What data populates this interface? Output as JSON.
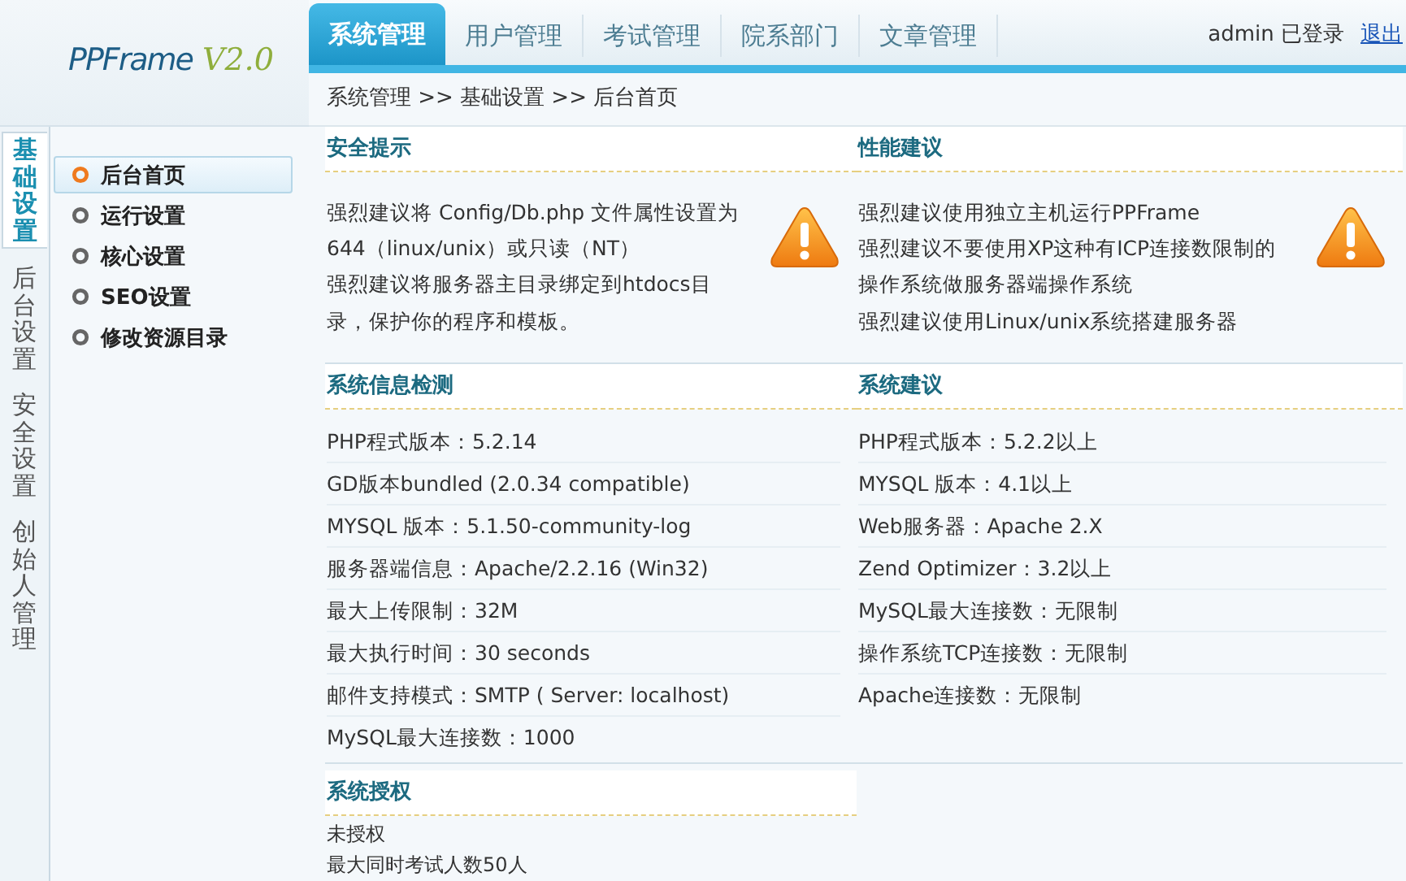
{
  "logo": {
    "name": "PPFrame",
    "version": "V2.0"
  },
  "tabs": [
    {
      "label": "系统管理",
      "selected": true
    },
    {
      "label": "用户管理",
      "selected": false
    },
    {
      "label": "考试管理",
      "selected": false
    },
    {
      "label": "院系部门",
      "selected": false
    },
    {
      "label": "文章管理",
      "selected": false
    }
  ],
  "user": {
    "status": "admin 已登录",
    "logout": "退出"
  },
  "breadcrumb": "系统管理 >> 基础设置 >> 后台首页",
  "side_tabs": [
    {
      "label": "基础设置",
      "selected": true
    },
    {
      "label": "后台设置",
      "selected": false
    },
    {
      "label": "安全设置",
      "selected": false
    },
    {
      "label": "创始人管理",
      "selected": false
    }
  ],
  "menu": [
    {
      "label": "后台首页",
      "selected": true
    },
    {
      "label": "运行设置",
      "selected": false
    },
    {
      "label": "核心设置",
      "selected": false
    },
    {
      "label": "SEO设置",
      "selected": false
    },
    {
      "label": "修改资源目录",
      "selected": false
    }
  ],
  "notices": [
    {
      "title": "安全提示",
      "lines": [
        "强烈建议将 Config/Db.php 文件属性设置为",
        "644（linux/unix）或只读（NT）",
        "强烈建议将服务器主目录绑定到htdocs目",
        "录，保护你的程序和模板。"
      ]
    },
    {
      "title": "性能建议",
      "lines": [
        "强烈建议使用独立主机运行PPFrame",
        "强烈建议不要使用XP这种有ICP连接数限制的",
        "操作系统做服务器端操作系统",
        "强烈建议使用Linux/unix系统搭建服务器"
      ]
    }
  ],
  "info_panels": [
    {
      "title": "系统信息检测",
      "rows": [
        "PHP程式版本：5.2.14",
        "GD版本bundled (2.0.34 compatible)",
        "MYSQL 版本：5.1.50-community-log",
        "服务器端信息：Apache/2.2.16 (Win32)",
        "最大上传限制：32M",
        "最大执行时间：30 seconds",
        "邮件支持模式：SMTP ( Server: localhost)",
        "MySQL最大连接数：1000"
      ]
    },
    {
      "title": "系统建议",
      "rows": [
        "PHP程式版本：5.2.2以上",
        "MYSQL 版本：4.1以上",
        "Web服务器：Apache 2.X",
        "Zend Optimizer：3.2以上",
        "MySQL最大连接数：无限制",
        "操作系统TCP连接数：无限制",
        "Apache连接数：无限制"
      ]
    }
  ],
  "license": {
    "title": "系统授权",
    "lines": [
      "未授权",
      "最大同时考试人数50人"
    ]
  }
}
